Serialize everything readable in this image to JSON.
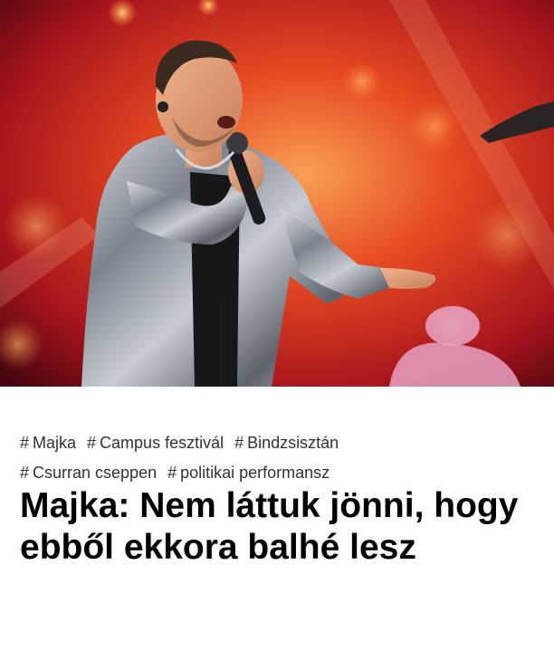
{
  "article": {
    "image": {
      "subject": "singer performing on stage with microphone, silver jacket, red stage lights"
    },
    "tags_row1": [
      {
        "hash": "#",
        "label": "Majka"
      },
      {
        "hash": "#",
        "label": "Campus fesztivál"
      },
      {
        "hash": "#",
        "label": "Bindzsisztán"
      }
    ],
    "tags_row2": [
      {
        "hash": "#",
        "label": "Csurran cseppen"
      },
      {
        "hash": "#",
        "label": "politikai performansz"
      }
    ],
    "headline": "Majka: Nem láttuk jönni, hogy ebből ekkora balhé lesz"
  },
  "colors": {
    "stage_red": "#e0391c",
    "stage_orange": "#f07a2a",
    "jacket_silver": "#9ea3ab",
    "text": "#000000",
    "tag_text": "#333333"
  }
}
